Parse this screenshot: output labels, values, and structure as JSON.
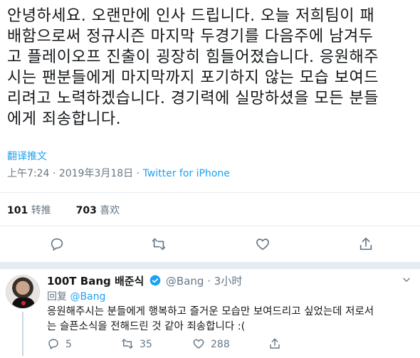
{
  "tweet": {
    "text": "안녕하세요. 오랜만에 인사 드립니다. 오늘 저희팀이 패\n배함으로써 정규시즌 마지막 두경기를 다음주에 남겨두\n고 플레이오프 진출이 굉장히 힘들어졌습니다. 응원해주\n시는 팬분들에게 마지막까지 포기하지 않는 모습 보여드\n리려고 노력하겠습니다. 경기력에 실망하셨을 모든 분들\n에게 죄송합니다.",
    "translate_label": "翻译推文",
    "time": "上午7:24",
    "date": "2019年3月18日",
    "separator": "·",
    "source": "Twitter for iPhone"
  },
  "stats": {
    "retweets_count": "101",
    "retweets_label": "转推",
    "likes_count": "703",
    "likes_label": "喜欢"
  },
  "actions": {
    "reply_icon": "reply-icon",
    "retweet_icon": "retweet-icon",
    "like_icon": "heart-icon",
    "share_icon": "share-icon"
  },
  "reply": {
    "name": "100T Bang 배준식",
    "handle": "@Bang",
    "dot": "·",
    "time": "3小时",
    "replying_label": "回复",
    "replying_to": "@Bang",
    "text": "응원해주시는 분들에게 행복하고 즐거운 모습만 보여드리고 싶었는데 저로서\n는 슬픈소식을 전해드린 것 같아 죄송합니다 :(",
    "reply_count": "5",
    "retweet_count": "35",
    "like_count": "288"
  },
  "colors": {
    "accent": "#1da1f2",
    "muted": "#657786",
    "divider": "#e6ecf0"
  }
}
